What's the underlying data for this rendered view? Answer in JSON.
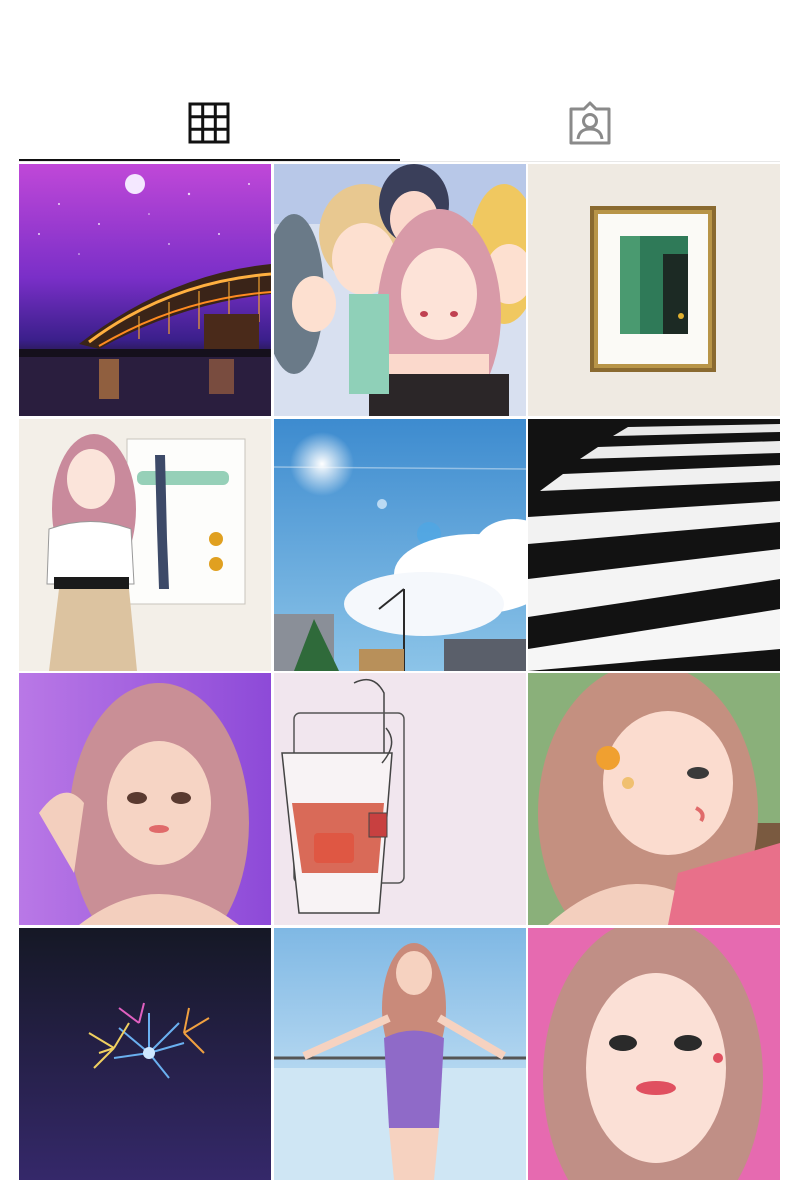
{
  "tabs": [
    {
      "name": "posts-grid",
      "icon": "grid-icon",
      "active": true
    },
    {
      "name": "tagged",
      "icon": "tagged-person-icon",
      "active": false
    }
  ],
  "colors": {
    "active_icon": "#111111",
    "inactive_icon": "#8a8a8a",
    "indicator": "#111111"
  },
  "grid": {
    "columns": 3,
    "posts": [
      {
        "id": "post-1",
        "subject": "night-bridge-illustration"
      },
      {
        "id": "post-2",
        "subject": "group-of-girls-illustration"
      },
      {
        "id": "post-3",
        "subject": "framed-green-painting"
      },
      {
        "id": "post-4",
        "subject": "girl-beside-artwork-illustration"
      },
      {
        "id": "post-5",
        "subject": "blue-sky-clouds-illustration"
      },
      {
        "id": "post-6",
        "subject": "crosswalk-stripes-illustration"
      },
      {
        "id": "post-7",
        "subject": "girl-purple-background-illustration"
      },
      {
        "id": "post-8",
        "subject": "iced-drink-glass-illustration"
      },
      {
        "id": "post-9",
        "subject": "girl-profile-earring-illustration"
      },
      {
        "id": "post-10",
        "subject": "fireworks-night-illustration"
      },
      {
        "id": "post-11",
        "subject": "girl-swimsuit-sky-illustration"
      },
      {
        "id": "post-12",
        "subject": "girl-close-up-pink-illustration"
      }
    ]
  }
}
